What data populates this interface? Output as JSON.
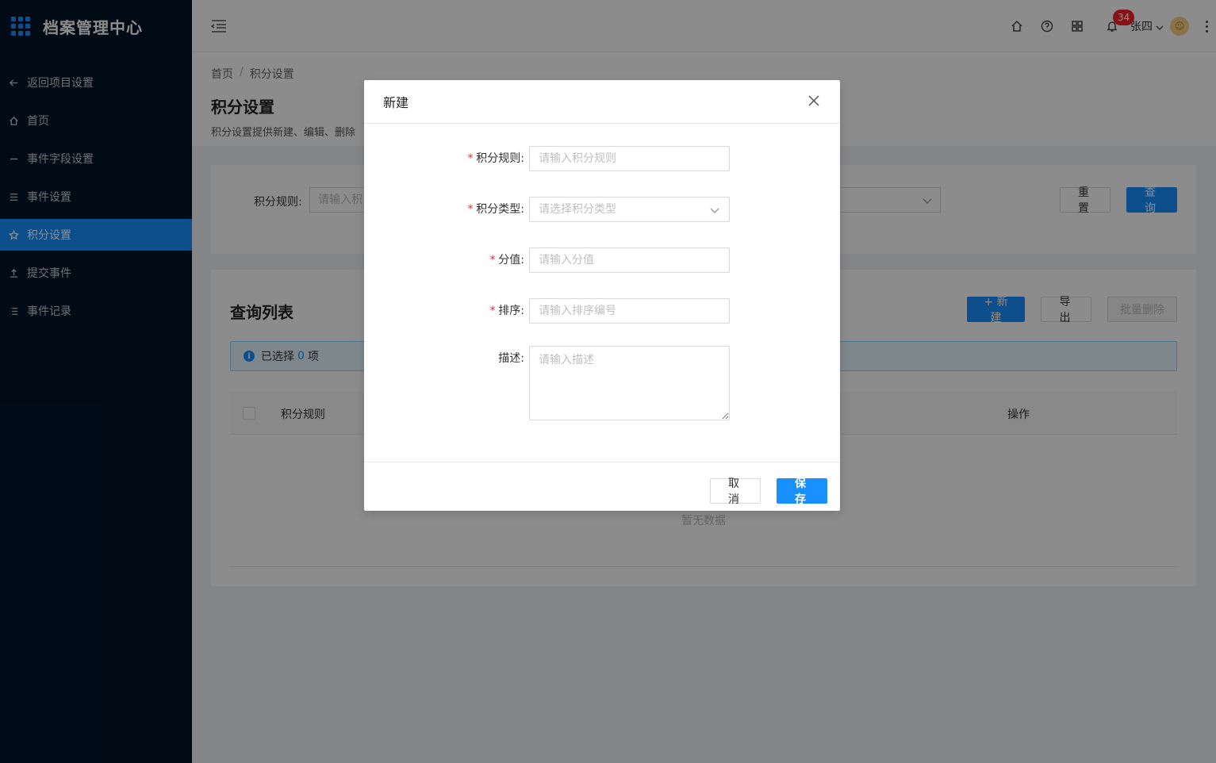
{
  "brand": {
    "title": "档案管理中心"
  },
  "sidebar": {
    "items": [
      {
        "label": "返回项目设置",
        "icon": "arrow-left-icon"
      },
      {
        "label": "首页",
        "icon": "home-icon"
      },
      {
        "label": "事件字段设置",
        "icon": "minus-icon"
      },
      {
        "label": "事件设置",
        "icon": "menu-icon"
      },
      {
        "label": "积分设置",
        "icon": "star-icon",
        "active": true
      },
      {
        "label": "提交事件",
        "icon": "upload-icon"
      },
      {
        "label": "事件记录",
        "icon": "list-icon"
      }
    ]
  },
  "header": {
    "notification_count": "34",
    "user_name": "张四"
  },
  "breadcrumb": {
    "home": "首页",
    "sep": "/",
    "current": "积分设置"
  },
  "page": {
    "title": "积分设置",
    "description": "积分设置提供新建、编辑、删除"
  },
  "search": {
    "rule_label": "积分规则:",
    "rule_placeholder": "请输入积",
    "reset_label": "重置",
    "query_label": "查询"
  },
  "list": {
    "title": "查询列表",
    "new_label": "+ 新建",
    "export_label": "导出",
    "batch_delete_label": "批量删除",
    "selected_prefix": "已选择",
    "selected_count": "0",
    "selected_suffix": "项",
    "col_rule": "积分规则",
    "col_action": "操作",
    "empty_text": "暂无数据"
  },
  "modal": {
    "title": "新建",
    "fields": {
      "rule": {
        "label": "积分规则:",
        "placeholder": "请输入积分规则",
        "value": ""
      },
      "type": {
        "label": "积分类型:",
        "placeholder": "请选择积分类型"
      },
      "score": {
        "label": "分值:",
        "placeholder": "请输入分值",
        "value": ""
      },
      "order": {
        "label": "排序:",
        "placeholder": "请输入排序编号",
        "value": ""
      },
      "desc": {
        "label": "描述:",
        "placeholder": "请输入描述",
        "value": ""
      }
    },
    "cancel_label": "取消",
    "save_label": "保存"
  },
  "colors": {
    "sidebar_bg": "#001529",
    "primary": "#1890ff",
    "required": "#f5222d",
    "badge": "#f5222d"
  }
}
